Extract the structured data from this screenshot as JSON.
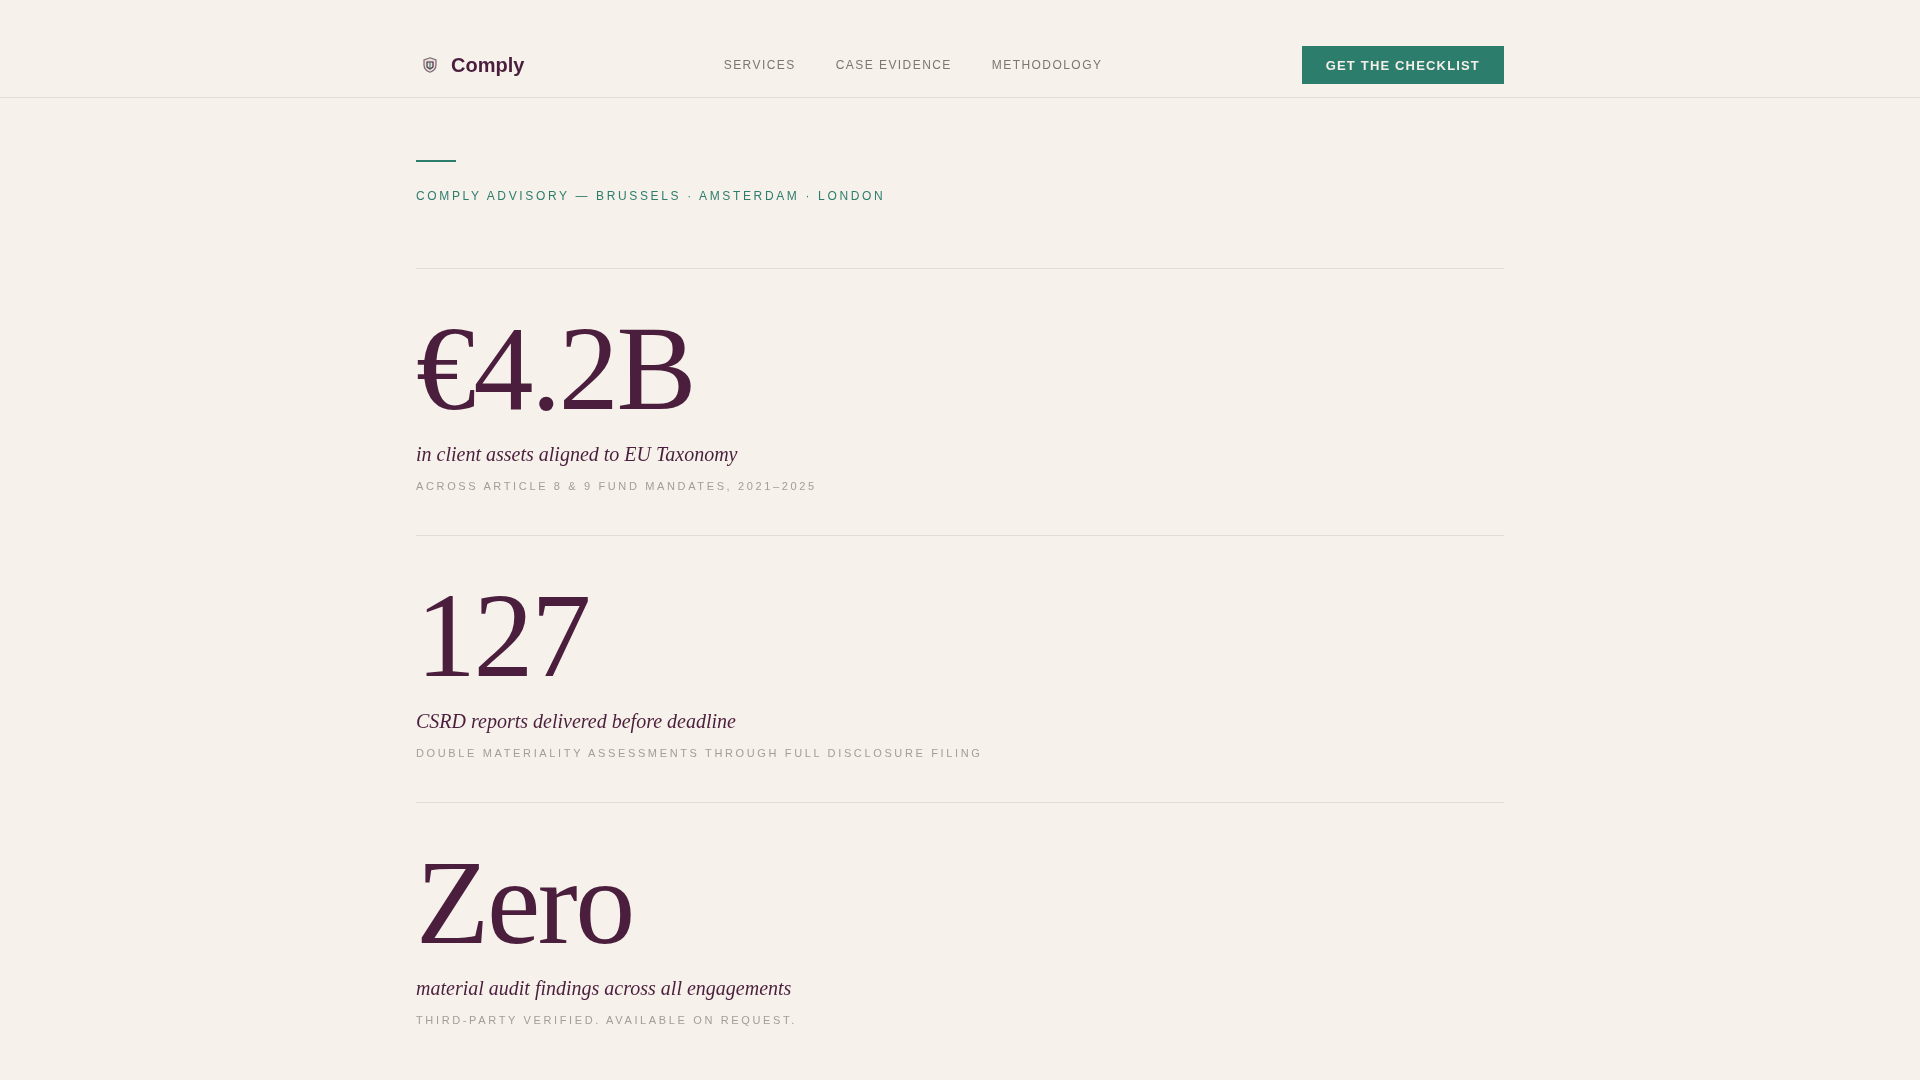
{
  "brand": {
    "name": "Comply"
  },
  "nav": {
    "links": [
      {
        "label": "SERVICES"
      },
      {
        "label": "CASE EVIDENCE"
      },
      {
        "label": "METHODOLOGY"
      }
    ],
    "cta": "GET THE CHECKLIST"
  },
  "hero": {
    "eyebrow": "COMPLY ADVISORY — BRUSSELS · AMSTERDAM · LONDON"
  },
  "stats": [
    {
      "value": "€4.2B",
      "caption": "in client assets aligned to EU Taxonomy",
      "note": "ACROSS ARTICLE 8 & 9 FUND MANDATES, 2021–2025"
    },
    {
      "value": "127",
      "caption": "CSRD reports delivered before deadline",
      "note": "DOUBLE MATERIALITY ASSESSMENTS THROUGH FULL DISCLOSURE FILING"
    },
    {
      "value": "Zero",
      "caption": "material audit findings across all engagements",
      "note": "THIRD-PARTY VERIFIED. AVAILABLE ON REQUEST."
    }
  ]
}
